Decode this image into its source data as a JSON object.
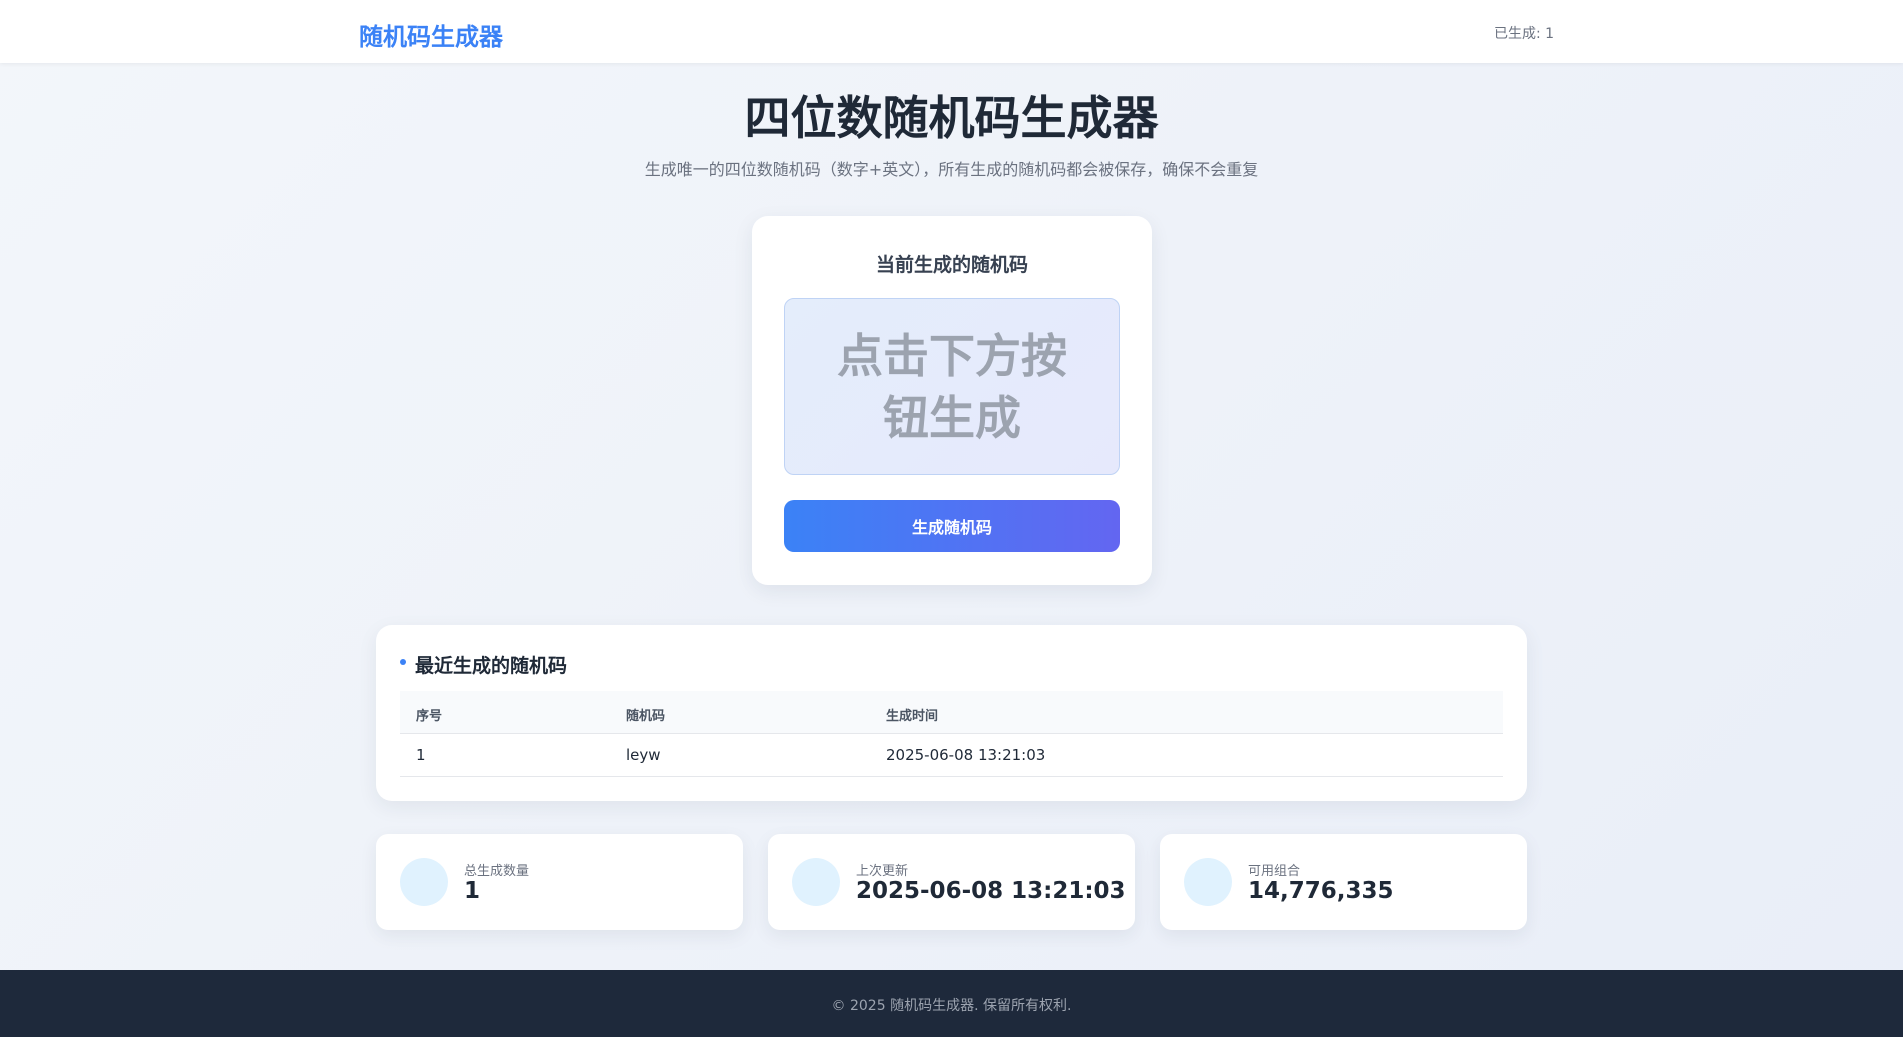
{
  "navbar": {
    "brand": "随机码生成器",
    "count_text": "已生成: 1"
  },
  "hero": {
    "title": "四位数随机码生成器",
    "subtitle": "生成唯一的四位数随机码（数字+英文），所有生成的随机码都会被保存，确保不会重复"
  },
  "generator": {
    "title": "当前生成的随机码",
    "display_text": "点击下方按钮生成",
    "button_label": "生成随机码"
  },
  "recent": {
    "title": "最近生成的随机码",
    "columns": [
      "序号",
      "随机码",
      "生成时间"
    ],
    "rows": [
      [
        "1",
        "leyw",
        "2025-06-08 13:21:03"
      ]
    ]
  },
  "stats": [
    {
      "label": "总生成数量",
      "value": "1"
    },
    {
      "label": "上次更新",
      "value": "2025-06-08 13:21:03"
    },
    {
      "label": "可用组合",
      "value": "14,776,335"
    }
  ],
  "footer": {
    "text": "© 2025 随机码生成器. 保留所有权利."
  }
}
